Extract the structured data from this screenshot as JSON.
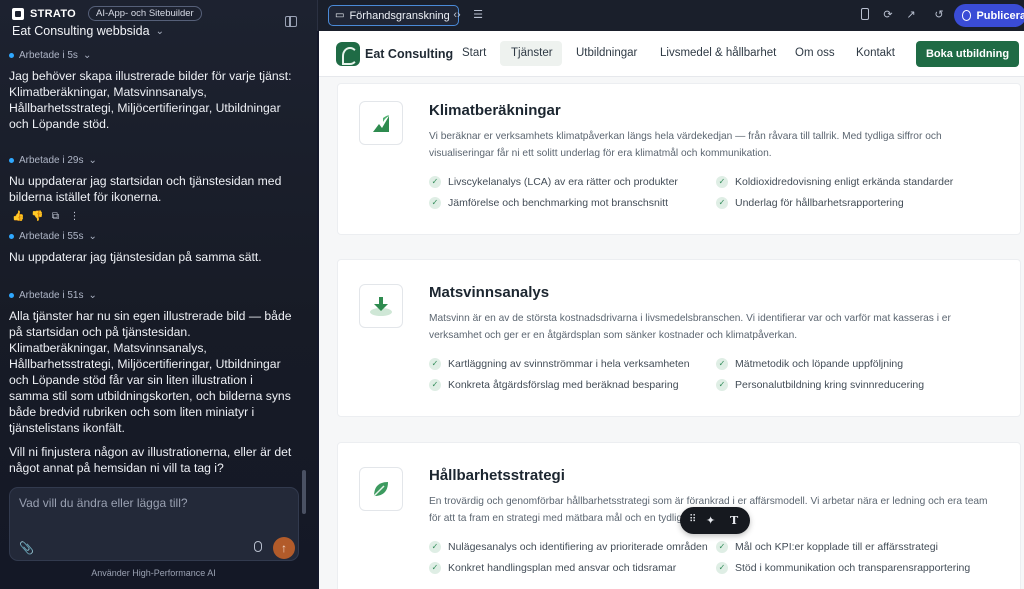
{
  "app": {
    "brand": "STRATO",
    "ai_badge": "AI-App- och Sitebuilder",
    "project": "Eat Consulting webbsida"
  },
  "chat": {
    "messages": [
      {
        "status": "Arbetade i 5s",
        "text": [
          "Jag behöver skapa illustrerade bilder för varje tjänst: Klimatberäkningar, Matsvinnsanalys, Hållbarhetsstrategi, Miljöcertifieringar, Utbildningar och Löpande stöd."
        ]
      },
      {
        "status": "Arbetade i 29s",
        "text": [
          "Nu uppdaterar jag startsidan och tjänstesidan med bilderna istället för ikonerna."
        ]
      },
      {
        "status": "Arbetade i 55s",
        "text": [
          "Nu uppdaterar jag tjänstesidan på samma sätt."
        ]
      },
      {
        "status": "Arbetade i 51s",
        "text": [
          "Alla tjänster har nu sin egen illustrerade bild — både på startsidan och på tjänstesidan. Klimatberäkningar, Matsvinnsanalys, Hållbarhetsstrategi, Miljöcertifieringar, Utbildningar och Löpande stöd får var sin liten illustration i samma stil som utbildningskorten, och bilderna syns både bredvid rubriken och som liten miniatyr i tjänstelistans ikonfält.",
          "Vill ni finjustera någon av illustrationerna, eller är det något annat på hemsidan ni vill ta tag i?"
        ]
      }
    ],
    "composer_placeholder": "Vad vill du ändra eller lägga till?",
    "footnote": "Använder High-Performance AI"
  },
  "toolbar": {
    "preview_label": "Förhandsgranskning",
    "publish_label": "Publicera"
  },
  "site": {
    "name": "Eat Consulting",
    "nav": [
      "Start",
      "Tjänster",
      "Utbildningar",
      "Livsmedel & hållbarhet",
      "Om oss",
      "Kontakt"
    ],
    "active_nav": "Tjänster",
    "cta": "Boka utbildning",
    "services": [
      {
        "title": "Klimatberäkningar",
        "desc": "Vi beräknar er verksamhets klimatpåverkan längs hela värdekedjan — från råvara till tallrik. Med tydliga siffror och visualiseringar får ni ett solitt underlag för era klimatmål och kommunikation.",
        "features": [
          "Livscykelanalys (LCA) av era rätter och produkter",
          "Koldioxidredovisning enligt erkända standarder",
          "Jämförelse och benchmarking mot branschsnitt",
          "Underlag för hållbarhetsrapportering"
        ]
      },
      {
        "title": "Matsvinnsanalys",
        "desc": "Matsvinn är en av de största kostnadsdrivarna i livsmedelsbranschen. Vi identifierar var och varför mat kasseras i er verksamhet och ger er en åtgärdsplan som sänker kostnader och klimatpåverkan.",
        "features": [
          "Kartläggning av svinnströmmar i hela verksamheten",
          "Mätmetodik och löpande uppföljning",
          "Konkreta åtgärdsförslag med beräknad besparing",
          "Personalutbildning kring svinnreducering"
        ]
      },
      {
        "title": "Hållbarhetsstrategi",
        "desc": "En trovärdig och genomförbar hållbarhetsstrategi som är förankrad i er affärsmodell. Vi arbetar nära er ledning och era team för att ta fram en strategi med mätbara mål och en tydlig handlingsplan.",
        "features": [
          "Nulägesanalys och identifiering av prioriterade områden",
          "Mål och KPI:er kopplade till er affärsstrategi",
          "Konkret handlingsplan med ansvar och tidsramar",
          "Stöd i kommunikation och transparensrapportering"
        ]
      }
    ]
  },
  "colors": {
    "brand_green": "#1f6b45",
    "publish_blue": "#3a4cd6",
    "status_dot": "#2fa8ff"
  }
}
